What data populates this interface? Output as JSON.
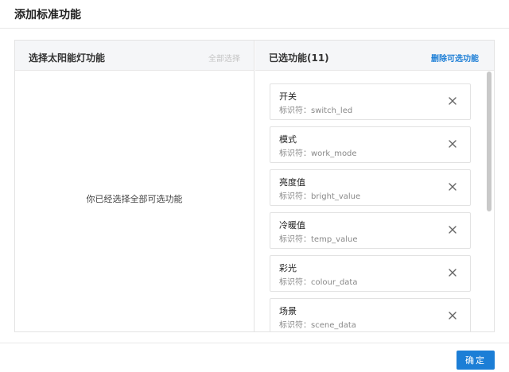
{
  "modal": {
    "title": "添加标准功能"
  },
  "left_panel": {
    "title": "选择太阳能灯功能",
    "select_all_label": "全部选择",
    "empty_message": "你已经选择全部可选功能"
  },
  "right_panel": {
    "title": "已选功能(11)",
    "remove_all_label": "删除可选功能",
    "items": [
      {
        "name": "开关",
        "identifier": "标识符：switch_led"
      },
      {
        "name": "模式",
        "identifier": "标识符：work_mode"
      },
      {
        "name": "亮度值",
        "identifier": "标识符：bright_value"
      },
      {
        "name": "冷暖值",
        "identifier": "标识符：temp_value"
      },
      {
        "name": "彩光",
        "identifier": "标识符：colour_data"
      },
      {
        "name": "场景",
        "identifier": "标识符：scene_data"
      }
    ]
  },
  "footer": {
    "confirm_label": "确定"
  },
  "colors": {
    "accent": "#1c7ed6",
    "border": "#e3e3e3",
    "header_bg": "#f5f6f8"
  },
  "icons": {
    "remove": "close-icon"
  }
}
